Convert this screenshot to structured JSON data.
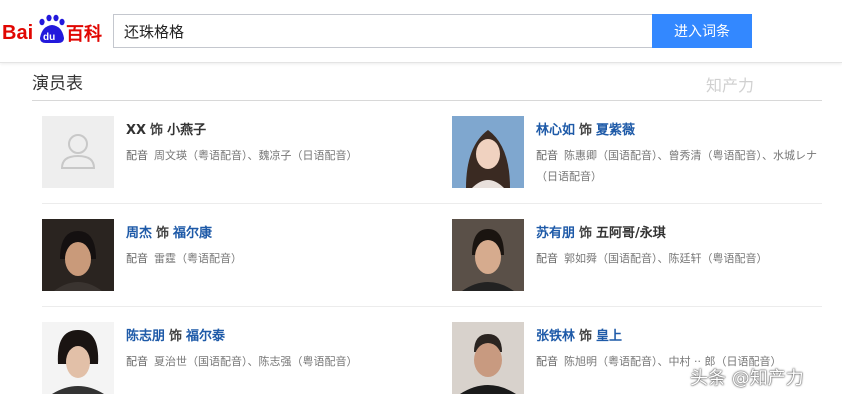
{
  "header": {
    "logo_text_bai": "Bai",
    "logo_text_du": "du",
    "logo_text_baike": "百科",
    "search_value": "还珠格格",
    "search_button": "进入词条"
  },
  "section": {
    "title": "演员表"
  },
  "cast": [
    {
      "actor": "XX",
      "shi": "饰",
      "role": "小燕子",
      "voice_label": "配音",
      "voice": "周文瑛（粤语配音）、魏凉子（日语配音）"
    },
    {
      "actor": "林心如",
      "shi": "饰",
      "role": "夏紫薇",
      "voice_label": "配音",
      "voice": "陈惠卿（国语配音）、曾秀清（粤语配音）、水城レナ（日语配音）"
    },
    {
      "actor": "周杰",
      "shi": "饰",
      "role": "福尔康",
      "voice_label": "配音",
      "voice": "雷霆（粤语配音）"
    },
    {
      "actor": "苏有朋",
      "shi": "饰",
      "role": "五阿哥/永琪",
      "voice_label": "配音",
      "voice": "郭如舜（国语配音）、陈廷轩（粤语配音）"
    },
    {
      "actor": "陈志朋",
      "shi": "饰",
      "role": "福尔泰",
      "voice_label": "配音",
      "voice": "夏治世（国语配音）、陈志强（粤语配音）"
    },
    {
      "actor": "张铁林",
      "shi": "饰",
      "role": "皇上",
      "voice_label": "配音",
      "voice": "陈旭明（粤语配音）、中村 ·· 郎（日语配音）"
    }
  ],
  "watermark": {
    "text": "头条 @知产力",
    "ghost": "知产力"
  },
  "colors": {
    "link": "#1e5aa8",
    "button": "#3388ff",
    "baidu_red": "#e10602",
    "baidu_blue": "#2319dc"
  }
}
